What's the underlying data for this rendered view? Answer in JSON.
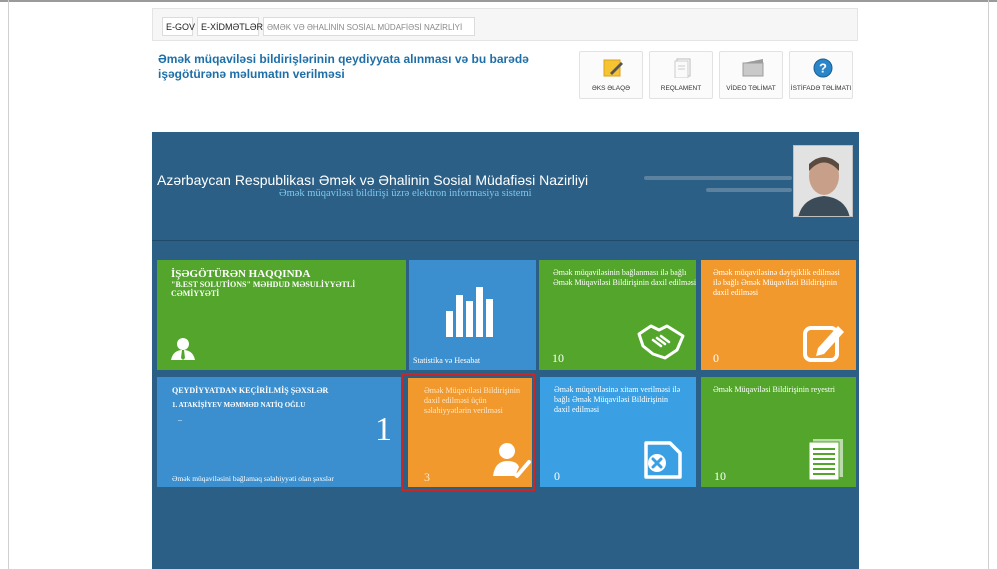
{
  "breadcrumbs": [
    "E-GOV",
    "E-XİDMƏTLƏR",
    "ƏMƏK VƏ ƏHALİNİN SOSİAL MÜDAFİƏSİ NAZİRLİYİ"
  ],
  "page_title": "Əmək müqaviləsi bildirişlərinin qeydiyyata alınması və bu barədə işəgötürənə məlumatın verilməsi",
  "toolbar": [
    {
      "label": "ƏKS ƏLAQƏ",
      "icon": "note-pencil-icon"
    },
    {
      "label": "REQLAMENT",
      "icon": "document-icon"
    },
    {
      "label": "VİDEO TƏLİMAT",
      "icon": "video-icon"
    },
    {
      "label": "İSTİFADƏ TƏLİMATI",
      "icon": "help-icon"
    }
  ],
  "banner": {
    "title": "Azərbaycan Respublikası Əmək və Əhalinin Sosial Müdafiəsi Nazirliyi",
    "subtitle": "Əmək müqaviləsi bildirişi üzrə elektron informasiya sistemi"
  },
  "tiles": {
    "employer": {
      "heading": "İŞƏGÖTÜRƏN HAQQINDA",
      "company": "\"B.EST SOLUTİONS\" MƏHDUD MƏSULİYYƏTLİ CƏMİYYƏTİ"
    },
    "stats": {
      "label": "Statistika və Hesabat"
    },
    "contract_submit": {
      "label": "Əmək müqaviləsinin bağlanması ilə bağlı Əmək Müqaviləsi Bildirişinin daxil edilməsi",
      "count": "10"
    },
    "contract_change": {
      "label": "Əmək müqaviləsinə dəyişiklik edilməsi ilə bağlı Əmək Müqaviləsi Bildirişinin daxil edilməsi",
      "count": "0"
    },
    "registered": {
      "heading": "QEYDİYYATDAN KEÇİRİLMİŞ ŞƏXSLƏR",
      "person": "1. ATAKİŞİYEV MƏMMƏD NATİQ OĞLU",
      "dash": "–",
      "count": "1",
      "footer": "Əmək müqaviləsini bağlamaq səlahiyyəti olan şəxslər"
    },
    "authority": {
      "label": "Əmək Müqaviləsi Bildirişinin daxil edilməsi üçün səlahiyyətlərin verilməsi",
      "count": "3"
    },
    "contract_terminate": {
      "label": "Əmək müqaviləsinə xitam verilməsi ilə bağlı Əmək Müqaviləsi Bildirişinin daxil edilməsi",
      "count": "0"
    },
    "registry": {
      "label": "Əmək Müqaviləsi Bildirişinin reyestri",
      "count": "10"
    }
  },
  "colors": {
    "banner": "#2b5f86",
    "green": "#53a62b",
    "blue": "#3b8fce",
    "light_blue": "#3aa0e3",
    "orange": "#f2992d",
    "highlight": "#c62828"
  }
}
